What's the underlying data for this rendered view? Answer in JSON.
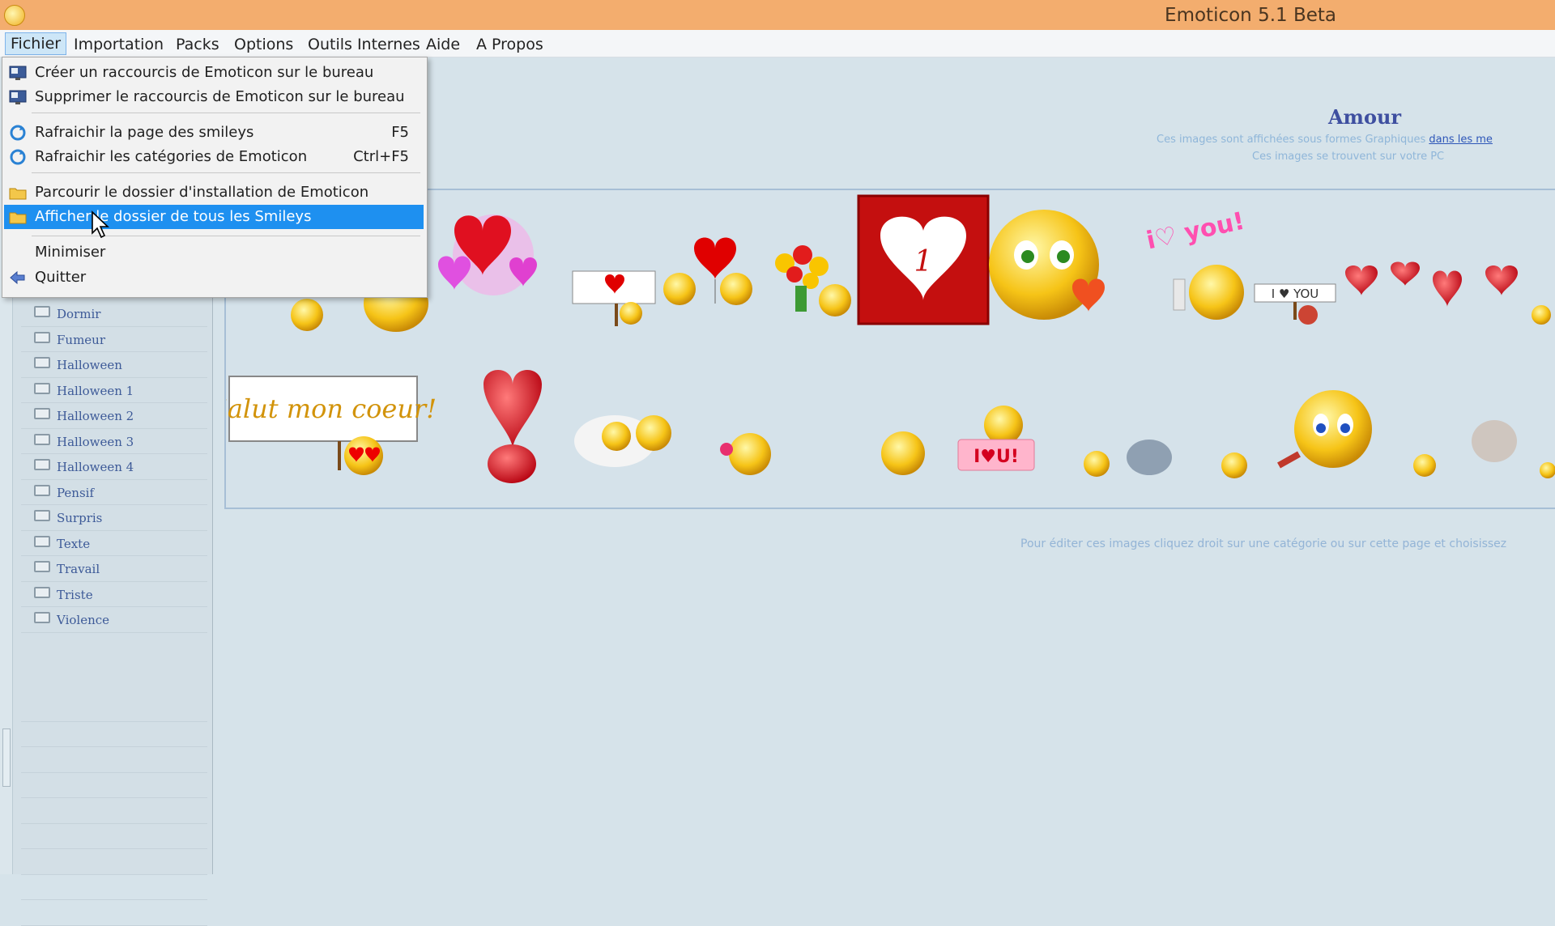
{
  "window": {
    "title": "Emoticon 5.1 Beta"
  },
  "menubar": {
    "items": [
      {
        "label": "Fichier"
      },
      {
        "label": "Importation"
      },
      {
        "label": "Packs"
      },
      {
        "label": "Options"
      },
      {
        "label": "Outils Internes"
      },
      {
        "label": "Aide"
      },
      {
        "label": "A Propos"
      }
    ]
  },
  "file_menu": {
    "items": [
      {
        "label": "Créer un raccourcis de Emoticon sur le bureau",
        "shortcut": "",
        "icon": "desktop-shortcut-icon"
      },
      {
        "label": "Supprimer le raccourcis de Emoticon sur le bureau",
        "shortcut": "",
        "icon": "desktop-shortcut-icon"
      },
      {
        "label": "Rafraichir la page des smileys",
        "shortcut": "F5",
        "icon": "refresh-icon"
      },
      {
        "label": "Rafraichir les catégories de Emoticon",
        "shortcut": "Ctrl+F5",
        "icon": "refresh-icon"
      },
      {
        "label": "Parcourir le dossier d'installation de Emoticon",
        "shortcut": "",
        "icon": "folder-icon"
      },
      {
        "label": "Afficher le dossier de tous les Smileys",
        "shortcut": "",
        "icon": "folder-icon",
        "highlighted": true
      },
      {
        "label": "Minimiser",
        "shortcut": "",
        "icon": ""
      },
      {
        "label": "Quitter",
        "shortcut": "",
        "icon": "exit-arrow-icon"
      }
    ]
  },
  "sidebar": {
    "categories": [
      {
        "label": "Dormir"
      },
      {
        "label": "Fumeur"
      },
      {
        "label": "Halloween"
      },
      {
        "label": "Halloween 1"
      },
      {
        "label": "Halloween 2"
      },
      {
        "label": "Halloween 3"
      },
      {
        "label": "Halloween 4"
      },
      {
        "label": "Pensif"
      },
      {
        "label": "Surpris"
      },
      {
        "label": "Texte"
      },
      {
        "label": "Travail"
      },
      {
        "label": "Triste"
      },
      {
        "label": "Violence"
      }
    ]
  },
  "content": {
    "heading": "Amour",
    "subtitle_1_text": "Ces images sont affichées sous formes Graphiques",
    "subtitle_1_link": "dans les me",
    "subtitle_2": "Ces images se trouvent sur votre PC",
    "emoticons": {
      "sign_text": "Salut mon coeur!",
      "i_love_you_sign": "I ♥ YOU",
      "i_love_u_sign": "I♥U!",
      "love_you_text": "i♡ you!",
      "heart_one": "1"
    },
    "bottom_note": "Pour éditer ces images cliquez droit sur une catégorie ou sur cette page et choisissez"
  },
  "colors": {
    "titlebar": "#f3ad6e",
    "menu_highlight": "#1e90f0",
    "background": "#d6e3ea",
    "heading": "#3e4fa0"
  }
}
